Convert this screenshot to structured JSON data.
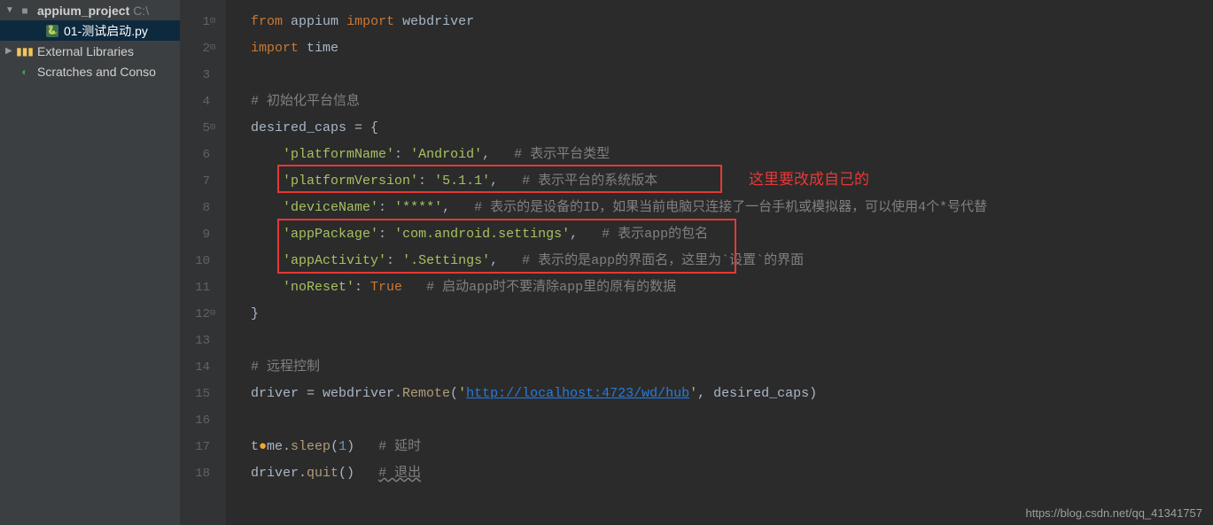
{
  "sidebar": {
    "project": {
      "name": "appium_project",
      "path": "C:\\"
    },
    "file": {
      "name": "01-测试启动.py"
    },
    "libraries": "External Libraries",
    "scratches": "Scratches and Conso"
  },
  "gutter": [
    "1",
    "2",
    "3",
    "4",
    "5",
    "6",
    "7",
    "8",
    "9",
    "10",
    "11",
    "12",
    "13",
    "14",
    "15",
    "16",
    "17",
    "18"
  ],
  "code": {
    "l1": {
      "kw1": "from",
      "mod": "appium",
      "kw2": "import",
      "name": "webdriver"
    },
    "l2": {
      "kw": "import",
      "name": "time"
    },
    "l4": {
      "cmt": "# 初始化平台信息"
    },
    "l5": {
      "var": "desired_caps",
      "eq": " = {"
    },
    "l6": {
      "k": "'platformName'",
      "v": "'Android'",
      "cmt": "# 表示平台类型"
    },
    "l7": {
      "k": "'platformVersion'",
      "v": "'5.1.1'",
      "cmt": "# 表示平台的系统版本"
    },
    "l8": {
      "k": "'deviceName'",
      "v": "'****'",
      "cmt": "# 表示的是设备的ID，如果当前电脑只连接了一台手机或模拟器，可以使用4个*号代替"
    },
    "l9": {
      "k": "'appPackage'",
      "v": "'com.android.settings'",
      "cmt": "# 表示app的包名"
    },
    "l10": {
      "k": "'appActivity'",
      "v": "'.Settings'",
      "cmt": "# 表示的是app的界面名，这里为`设置`的界面"
    },
    "l11": {
      "k": "'noReset'",
      "v": "True",
      "cmt": "# 启动app时不要清除app里的原有的数据"
    },
    "l12": {
      "brace": "}"
    },
    "l14": {
      "cmt": "# 远程控制"
    },
    "l15": {
      "a": "driver = webdriver.",
      "fn": "Remote",
      "p1": "(",
      "s1": "'",
      "url": "http://localhost:4723/wd/hub",
      "s2": "'",
      "p2": ", desired_caps)"
    },
    "l17": {
      "a": "t",
      "bulb": "●",
      "b": "me.",
      "fn": "sleep",
      "p1": "(",
      "n": "1",
      "p2": ")",
      "cmt": "# 延时"
    },
    "l18": {
      "a": "driver.",
      "fn": "quit",
      "p": "()",
      "cmt": "# 退出"
    }
  },
  "annotation": "这里要改成自己的",
  "watermark": "https://blog.csdn.net/qq_41341757"
}
